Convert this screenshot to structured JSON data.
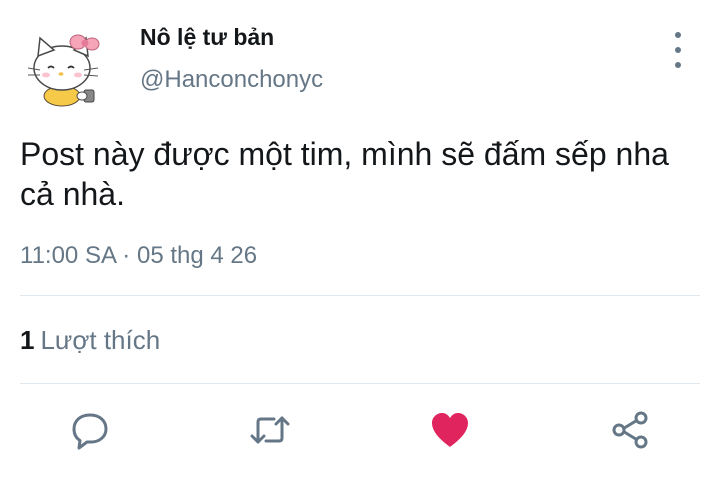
{
  "author": {
    "display_name": "Nô lệ tư bản",
    "handle": "@Hanconchonyc",
    "avatar": "hello-kitty-avatar"
  },
  "tweet": {
    "text": "Post này được một tim, mình sẽ đấm sếp nha cả nhà.",
    "timestamp": "11:00 SA · 05 thg 4 26"
  },
  "stats": {
    "like_count": "1",
    "like_label": "Lượt thích"
  },
  "actions": {
    "reply_icon": "reply-icon",
    "retweet_icon": "retweet-icon",
    "like_icon": "heart-icon",
    "share_icon": "share-icon",
    "more_icon": "more-vertical-icon"
  },
  "colors": {
    "text_primary": "#14171a",
    "text_secondary": "#657786",
    "like_active": "#e0245e",
    "divider": "#e1e8ed"
  }
}
